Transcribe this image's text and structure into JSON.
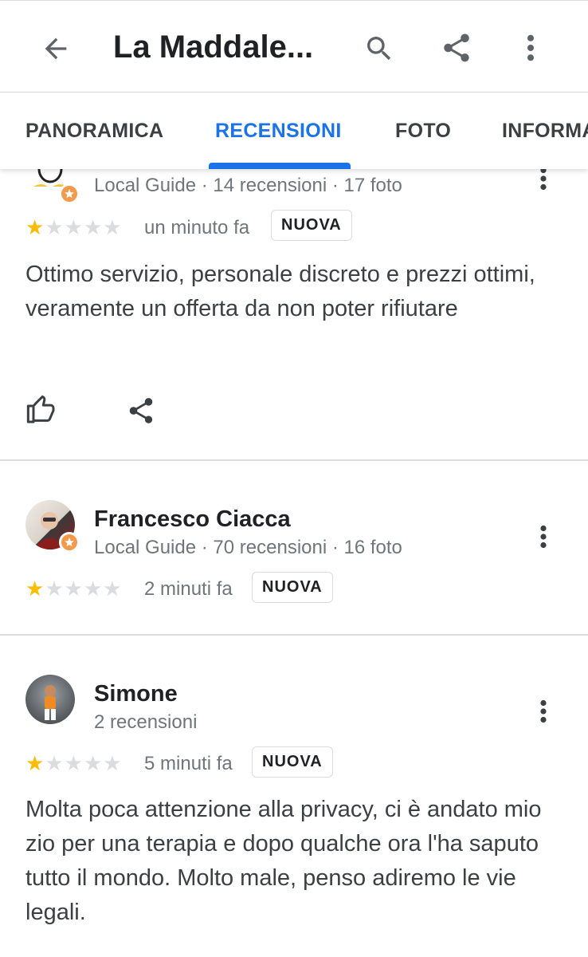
{
  "header": {
    "title": "La Maddale..."
  },
  "tabs": [
    {
      "label": "PANORAMICA"
    },
    {
      "label": "RECENSIONI"
    },
    {
      "label": "FOTO"
    },
    {
      "label": "INFORMA"
    }
  ],
  "colors": {
    "accent": "#1a73e8",
    "star": "#fbbc04",
    "guide_badge": "#f2994a"
  },
  "reviews": [
    {
      "meta": "Local Guide · 14 recensioni · 17 foto",
      "rating": 1,
      "time": "un minuto fa",
      "badge": "NUOVA",
      "text": "Ottimo servizio, personale discreto e prezzi ottimi, veramente un offerta da non poter rifiutare"
    },
    {
      "name": "Francesco Ciacca",
      "meta": "Local Guide · 70 recensioni · 16 foto",
      "rating": 1,
      "time": "2 minuti fa",
      "badge": "NUOVA"
    },
    {
      "name": "Simone",
      "meta": "2 recensioni",
      "rating": 1,
      "time": "5 minuti fa",
      "badge": "NUOVA",
      "text": "Molta poca attenzione alla privacy, ci è andato mio zio per una terapia e dopo qualche ora l'ha saputo tutto il mondo. Molto male, penso adiremo le vie legali."
    }
  ]
}
